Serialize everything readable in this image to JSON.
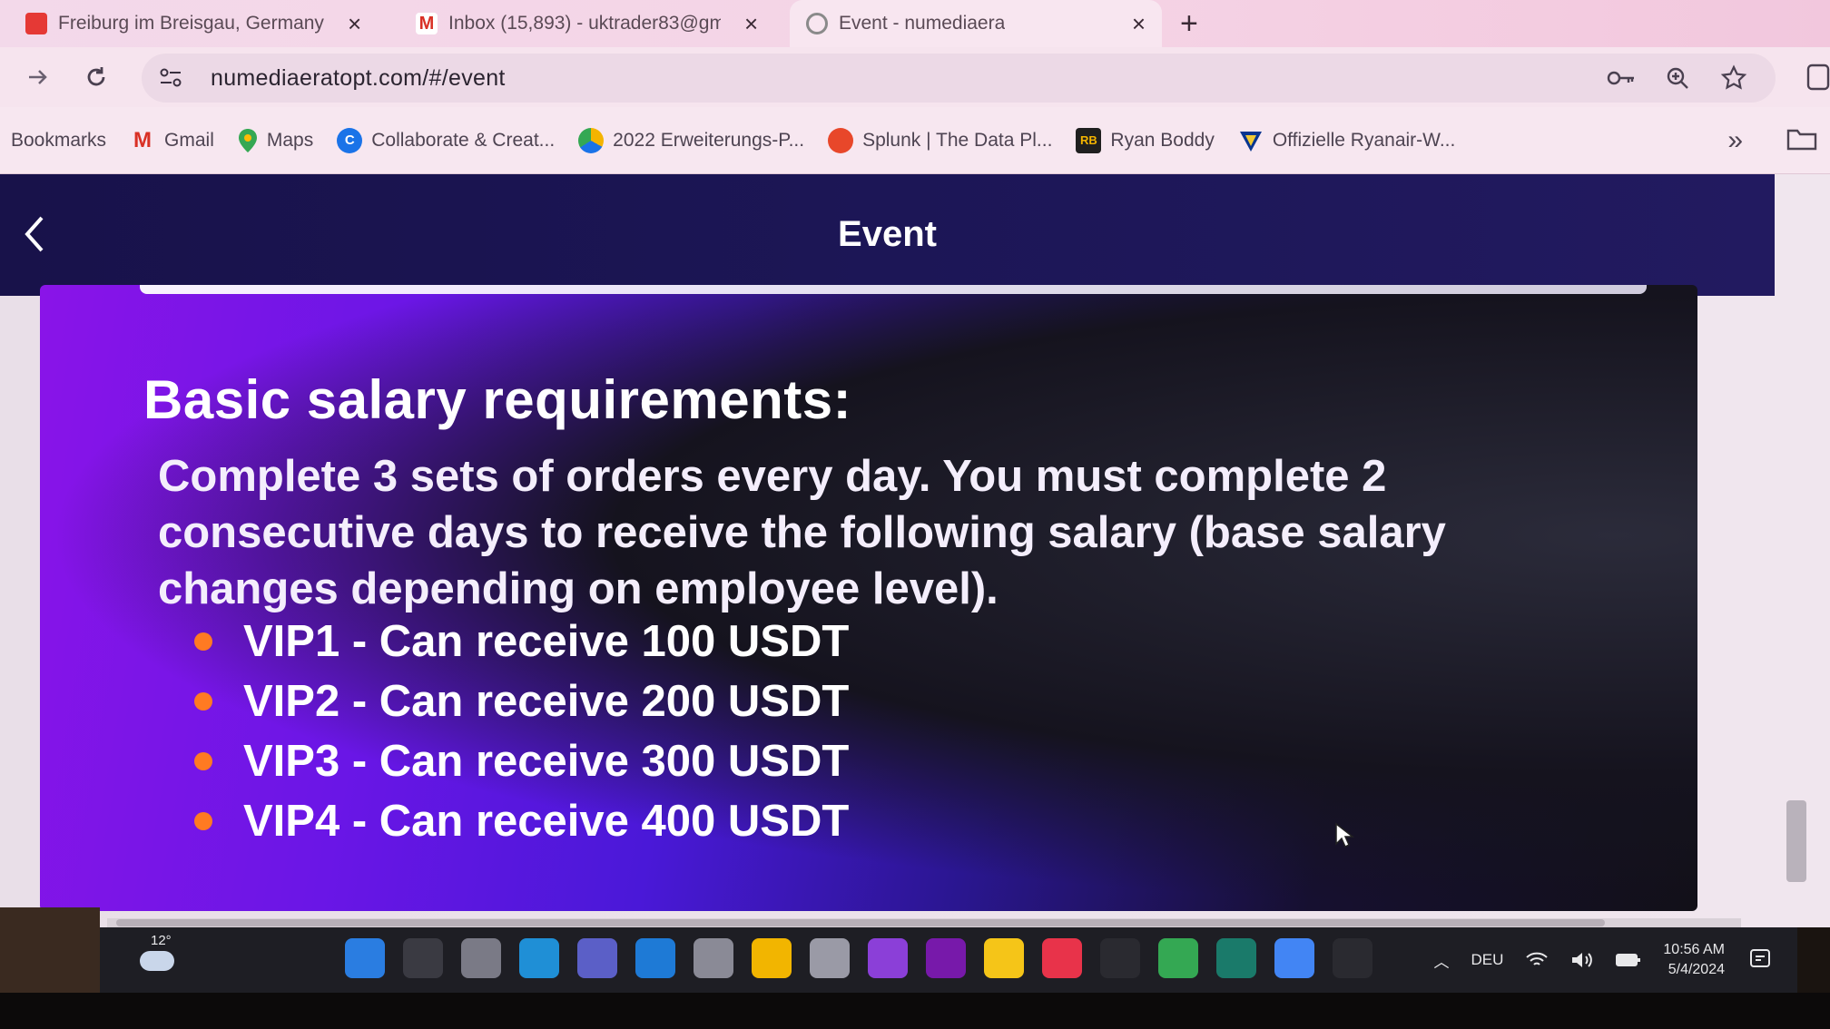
{
  "tabs": [
    {
      "title": "Freiburg im Breisgau, Germany",
      "favicon": "youtube-icon",
      "color": "#e53935"
    },
    {
      "title": "Inbox (15,893) - uktrader83@gm",
      "favicon": "gmail-icon",
      "color": "#d93025"
    },
    {
      "title": "Event - numediaera",
      "favicon": "globe-icon",
      "color": "#8a8a8a",
      "active": true
    }
  ],
  "toolbar": {
    "url": "numediaeratopt.com/#/event"
  },
  "bookmarks": [
    {
      "label": "Bookmarks",
      "icon": "",
      "color": ""
    },
    {
      "label": "Gmail",
      "icon": "M",
      "color": "#d93025"
    },
    {
      "label": "Maps",
      "icon": "map-pin-icon",
      "color": "#34a853"
    },
    {
      "label": "Collaborate & Creat...",
      "icon": "C",
      "color": "#1a73e8"
    },
    {
      "label": "2022 Erweiterungs-P...",
      "icon": "globe-icon",
      "color": "#f4b400"
    },
    {
      "label": "Splunk | The Data Pl...",
      "icon": "splunk-icon",
      "color": "#e8472a"
    },
    {
      "label": "Ryan Boddy",
      "icon": "RB",
      "color": "#1f1f1f"
    },
    {
      "label": "Offizielle Ryanair-W...",
      "icon": "ryanair-icon",
      "color": "#073590"
    }
  ],
  "header": {
    "title": "Event"
  },
  "content": {
    "heading": "Basic salary requirements:",
    "description": "Complete 3 sets of orders every day. You must complete 2 consecutive days to receive the following salary (base salary changes depending on employee level).",
    "vip_levels": [
      {
        "text": "VIP1 - Can receive 100 USDT"
      },
      {
        "text": "VIP2 - Can receive 200 USDT"
      },
      {
        "text": "VIP3 - Can receive 300 USDT"
      },
      {
        "text": "VIP4 - Can receive 400 USDT"
      }
    ]
  },
  "taskbar": {
    "temperature": "12°",
    "language": "DEU",
    "time": "10:56 AM",
    "date": "5/4/2024",
    "apps": [
      {
        "name": "windows-start-icon",
        "color": "#2a7de1"
      },
      {
        "name": "search-icon",
        "color": "#3a3a42"
      },
      {
        "name": "task-view-icon",
        "color": "#7a7a86"
      },
      {
        "name": "edge-icon",
        "color": "#1f8fd6"
      },
      {
        "name": "teams-icon",
        "color": "#5b5fc7"
      },
      {
        "name": "mail-icon",
        "color": "#1e7ad6"
      },
      {
        "name": "settings-icon",
        "color": "#8a8a96"
      },
      {
        "name": "file-explorer-icon",
        "color": "#f2b500"
      },
      {
        "name": "usb-icon",
        "color": "#9a9aa6"
      },
      {
        "name": "clipchamp-icon",
        "color": "#8b3fd8"
      },
      {
        "name": "onenote-icon",
        "color": "#7719aa"
      },
      {
        "name": "sticky-notes-icon",
        "color": "#f5c518"
      },
      {
        "name": "record-icon",
        "color": "#e8334a"
      },
      {
        "name": "app-wave-icon",
        "color": "#2a2a30"
      },
      {
        "name": "chrome-icon",
        "color": "#34a853"
      },
      {
        "name": "download-app-icon",
        "color": "#1a7a6a"
      },
      {
        "name": "chrome-profile-icon",
        "color": "#4285f4"
      },
      {
        "name": "app-wave-2-icon",
        "color": "#2a2a30"
      }
    ]
  },
  "colors": {
    "header_bg": "#1c1656",
    "banner_start": "#8a14e8",
    "bullet": "#ff7a22"
  }
}
